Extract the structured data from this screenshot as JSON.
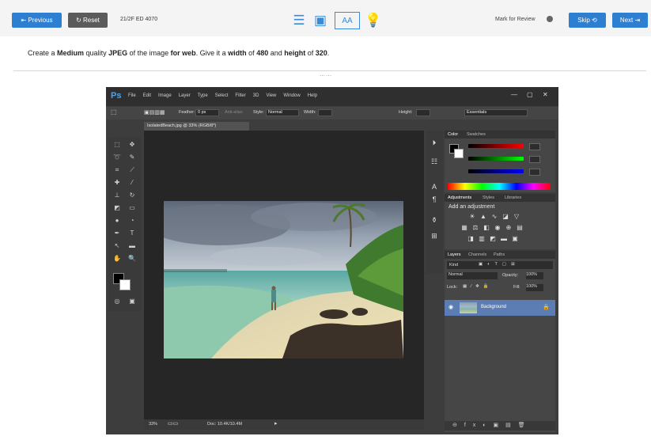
{
  "toolbar": {
    "previous_label": "⇤ Previous",
    "reset_label": "↻ Reset",
    "question_id": "21/2F ED 4070",
    "mark_for_review_label": "Mark for Review",
    "skip_label": "Skip ⟲",
    "next_label": "Next ⇥"
  },
  "instruction": {
    "p1": "Create a ",
    "b1": "Medium",
    "p2": " quality ",
    "b2": "JPEG",
    "p3": " of the image ",
    "b3": "for web",
    "p4": ". Give it a ",
    "b4": "width",
    "p5": " of ",
    "b5": "480",
    "p6": " and ",
    "b6": "height",
    "p7": " of ",
    "b7": "320",
    "p8": "."
  },
  "grip": "⋯⋯",
  "photoshop": {
    "logo": "Ps",
    "menu": [
      "File",
      "Edit",
      "Image",
      "Layer",
      "Type",
      "Select",
      "Filter",
      "3D",
      "View",
      "Window",
      "Help"
    ],
    "window_controls": [
      "—",
      "▢",
      "✕"
    ],
    "options": {
      "feather_label": "Feather:",
      "feather_value": "0 px",
      "antialias_label": "Anti-alias",
      "style_label": "Style:",
      "style_value": "Normal",
      "width_label": "Width:",
      "height_label": "Height:",
      "workspace_value": "Essentials"
    },
    "document_tab": "IsolatedBeach.jpg @ 33% (RGB/8*)",
    "status": {
      "zoom": "33%",
      "doc": "Doc: 10.4K/10.4M"
    },
    "panels": {
      "color_tabs": [
        "Color",
        "Swatches"
      ],
      "adjust_tabs": [
        "Adjustments",
        "Styles",
        "Libraries"
      ],
      "adjust_title": "Add an adjustment",
      "layers_tabs": [
        "Layers",
        "Channels",
        "Paths"
      ],
      "kind_label": "Kind",
      "blend_mode": "Normal",
      "opacity_label": "Opacity:",
      "opacity_value": "100%",
      "lock_label": "Lock:",
      "fill_label": "Fill:",
      "fill_value": "100%",
      "layer_name": "Background"
    }
  },
  "colors": {
    "accent": "#2d7fd2",
    "ps_dark": "#3d3d3d",
    "layer_selected": "#5c7db4"
  }
}
